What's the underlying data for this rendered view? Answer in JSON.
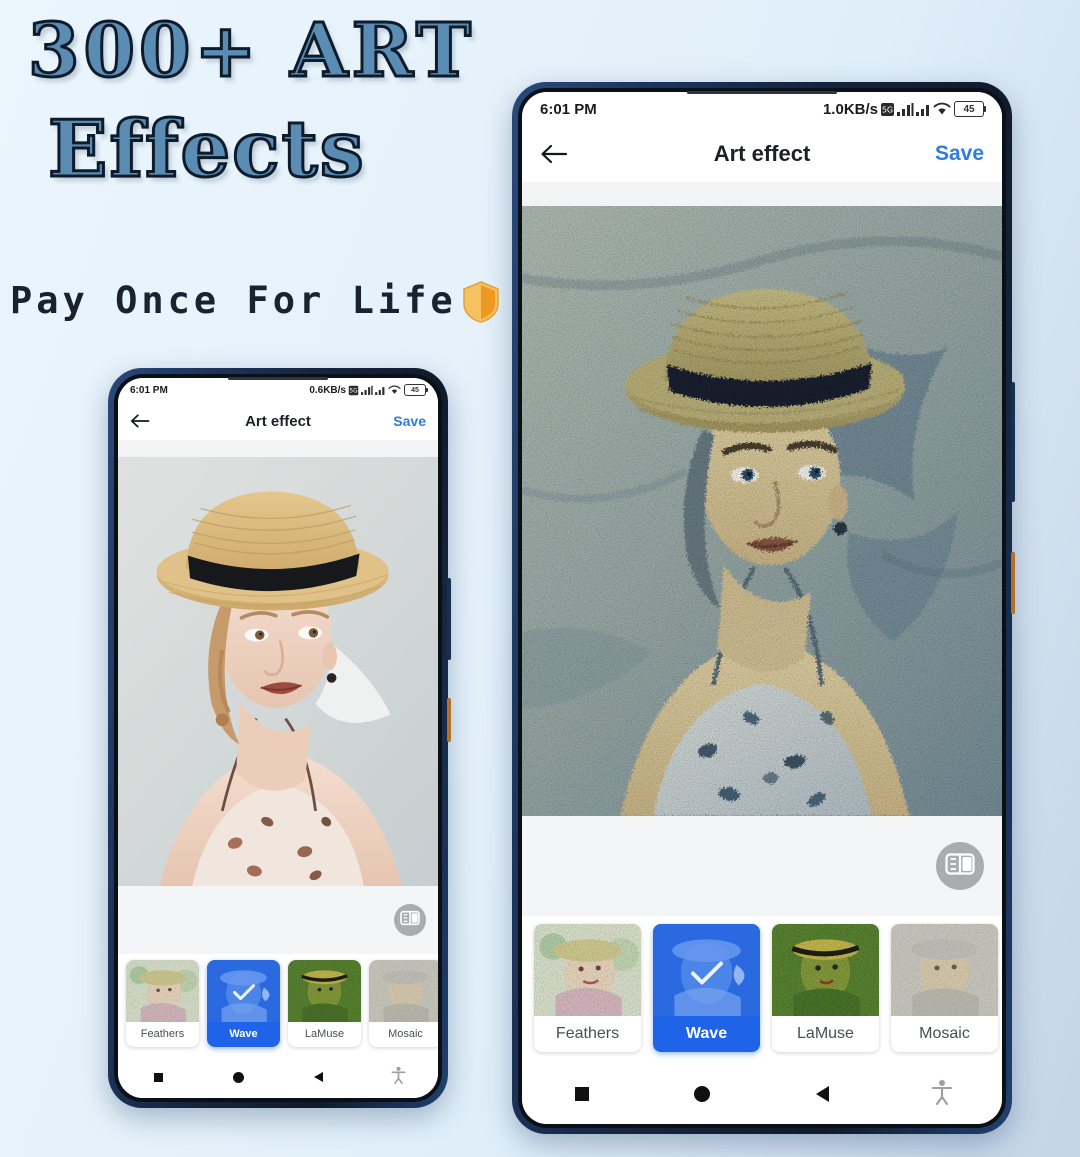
{
  "promo": {
    "line1": "300+ ART",
    "line2": "Effects",
    "line3": "Pay Once For Life",
    "shield_icon": "shield-icon",
    "text_fill_color": "#5b8cb3",
    "text_stroke_color": "#0d1b2a",
    "tagline_color": "#1a2230",
    "shield_color": "#f0a030",
    "background_colors": [
      "#eaf5fc",
      "#c4d5e8"
    ]
  },
  "phones": [
    {
      "id": "phone-large",
      "status_bar": {
        "time": "6:01 PM",
        "network_speed": "1.0KB/s",
        "icons": [
          "data-saver-icon",
          "signal-bars-icon",
          "signal-bars-icon",
          "wifi-icon"
        ],
        "battery_level": "45"
      },
      "app_bar": {
        "back_icon": "arrow-left-icon",
        "title": "Art effect",
        "save_label": "Save",
        "save_color": "#2f7ce0"
      },
      "tools": {
        "compare_icon": "compare-split-icon"
      },
      "effects": [
        {
          "label": "Feathers",
          "selected": false
        },
        {
          "label": "Wave",
          "selected": true
        },
        {
          "label": "LaMuse",
          "selected": false
        },
        {
          "label": "Mosaic",
          "selected": false
        },
        {
          "label": "",
          "selected": false
        }
      ],
      "selected_effect": "Wave",
      "selected_color": "#1f63e8",
      "nav_bar": {
        "recents_icon": "square-icon",
        "home_icon": "circle-icon",
        "back_icon": "triangle-left-icon",
        "accessibility_icon": "accessibility-icon"
      }
    },
    {
      "id": "phone-small",
      "status_bar": {
        "time": "6:01 PM",
        "network_speed": "0.6KB/s",
        "icons": [
          "data-saver-icon",
          "signal-bars-icon",
          "signal-bars-icon",
          "wifi-icon"
        ],
        "battery_level": "45"
      },
      "app_bar": {
        "back_icon": "arrow-left-icon",
        "title": "Art effect",
        "save_label": "Save",
        "save_color": "#2f7ce0"
      },
      "tools": {
        "compare_icon": "compare-split-icon"
      },
      "effects": [
        {
          "label": "Feathers",
          "selected": false
        },
        {
          "label": "Wave",
          "selected": true
        },
        {
          "label": "LaMuse",
          "selected": false
        },
        {
          "label": "Mosaic",
          "selected": false
        },
        {
          "label": "",
          "selected": false
        }
      ],
      "selected_effect": "Wave",
      "selected_color": "#1f63e8",
      "nav_bar": {
        "recents_icon": "square-icon",
        "home_icon": "circle-icon",
        "back_icon": "triangle-left-icon",
        "accessibility_icon": "accessibility-icon"
      }
    }
  ]
}
